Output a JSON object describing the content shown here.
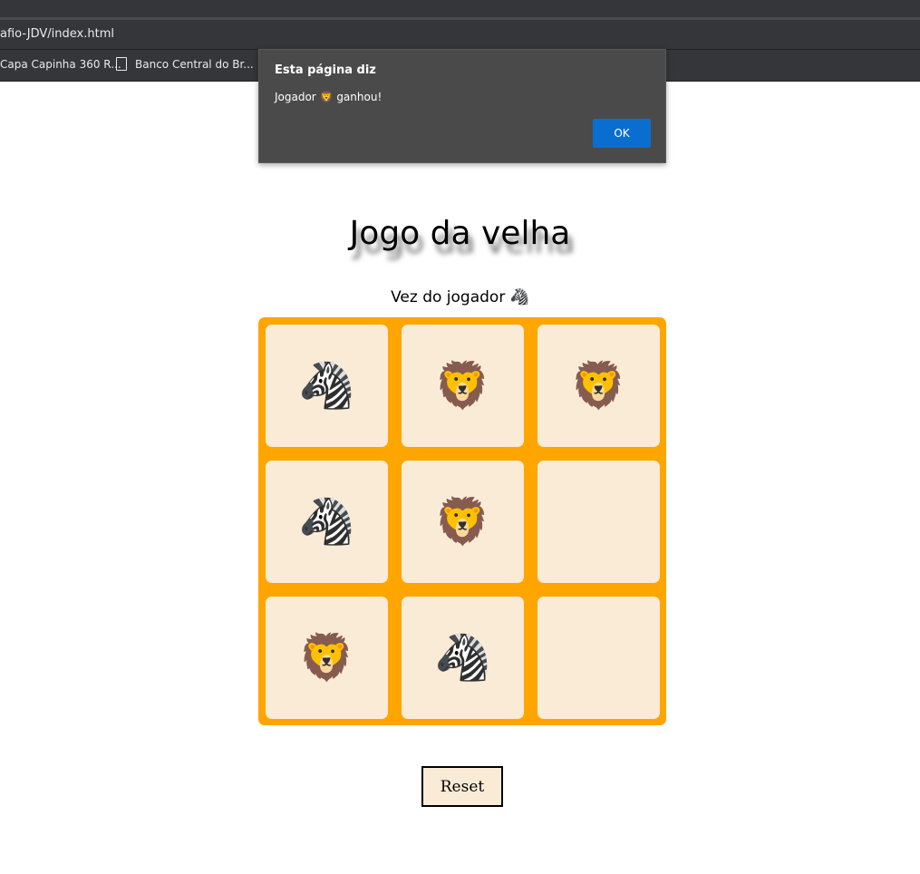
{
  "browser": {
    "url": "afio-JDV/index.html",
    "bookmarks": [
      {
        "label": "Capa Capinha 360 R..."
      },
      {
        "label": "Banco Central do Br..."
      }
    ]
  },
  "alert": {
    "title": "Esta página diz",
    "message": "Jogador 🦁 ganhou!",
    "ok_label": "OK"
  },
  "game": {
    "title": "Jogo da velha",
    "turn_text": "Vez do jogador 🦓",
    "board": [
      "🦓",
      "🦁",
      "🦁",
      "🦓",
      "🦁",
      "",
      "🦁",
      "🦓",
      ""
    ],
    "reset_label": "Reset"
  },
  "colors": {
    "board_border": "#ffa500",
    "cell_bg": "#faebd7",
    "alert_bg": "#4a4a4a",
    "ok_button": "#0a6ed1"
  }
}
